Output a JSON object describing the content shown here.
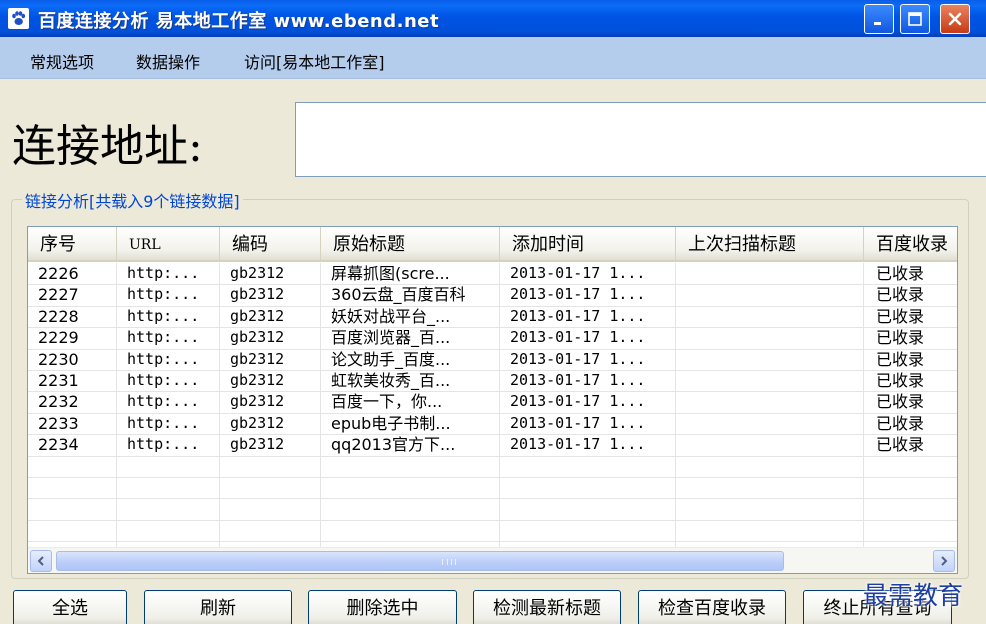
{
  "window": {
    "title": "百度连接分析  易本地工作室 www.ebend.net"
  },
  "menu": {
    "items": [
      "常规选项",
      "数据操作",
      "访问[易本地工作室]"
    ]
  },
  "address": {
    "label": "连接地址:",
    "value": ""
  },
  "group": {
    "title": "链接分析[共载入9个链接数据]"
  },
  "table": {
    "columns": [
      "序号",
      "URL",
      "编码",
      "原始标题",
      "添加时间",
      "上次扫描标题",
      "百度收录"
    ],
    "rows": [
      [
        "2226",
        "http:...",
        "gb2312",
        "屏幕抓图(scre...",
        "2013-01-17 1...",
        "",
        "已收录"
      ],
      [
        "2227",
        "http:...",
        "gb2312",
        "360云盘_百度百科",
        "2013-01-17 1...",
        "",
        "已收录"
      ],
      [
        "2228",
        "http:...",
        "gb2312",
        "妖妖对战平台_...",
        "2013-01-17 1...",
        "",
        "已收录"
      ],
      [
        "2229",
        "http:...",
        "gb2312",
        "百度浏览器_百...",
        "2013-01-17 1...",
        "",
        "已收录"
      ],
      [
        "2230",
        "http:...",
        "gb2312",
        "论文助手_百度...",
        "2013-01-17 1...",
        "",
        "已收录"
      ],
      [
        "2231",
        "http:...",
        "gb2312",
        "虹软美妆秀_百...",
        "2013-01-17 1...",
        "",
        "已收录"
      ],
      [
        "2232",
        "http:...",
        "gb2312",
        "百度一下，你...",
        "2013-01-17 1...",
        "",
        "已收录"
      ],
      [
        "2233",
        "http:...",
        "gb2312",
        "epub电子书制...",
        "2013-01-17 1...",
        "",
        "已收录"
      ],
      [
        "2234",
        "http:...",
        "gb2312",
        "qq2013官方下...",
        "2013-01-17 1...",
        "",
        "已收录"
      ]
    ]
  },
  "buttons": {
    "select_all": "全选",
    "refresh": "刷新",
    "delete_selected": "删除选中",
    "check_title": "检测最新标题",
    "check_baidu": "检查百度收录",
    "stop_all": "终止所有查询"
  },
  "watermark": "最需教育",
  "icons": {
    "app": "paw-icon",
    "minimize": "minimize-icon",
    "maximize": "maximize-icon",
    "close": "close-icon"
  },
  "colors": {
    "titlebar": "#0054E3",
    "menubar": "#B5CDED",
    "group_title": "#0046D5",
    "window_bg": "#ECE9D8"
  }
}
